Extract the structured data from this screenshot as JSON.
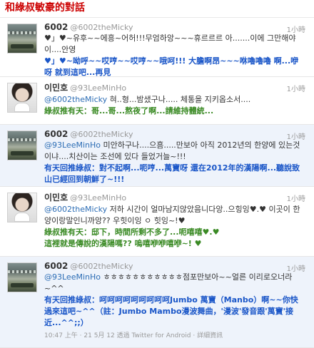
{
  "page_title": "和綠叔敏豪的對話",
  "tweets": [
    {
      "name": "6002",
      "handle": "@6002theMicky",
      "time": "1小時",
      "text": "♥」♥~유후~~에흥~어허!!!무엄하앙~~~휴르르르 아.......이에 그만해야이....안영",
      "translation": "♥」♥~呦呼~~哎哼~~哎哼~~哦呵!!! 大膽啊昂~~~咻嚕嚕嚕 啊...咿呀 就到這吧...再見"
    },
    {
      "name": "이민호",
      "handle": "@93LeeMinHo",
      "time": "1小時",
      "text_mention": "@6002theMicky",
      "text": "혀..형...밤샜구나..... 체통을 지키옵소서....",
      "translation": "綠叔推有天：哥...哥...熬夜了啊...請維持體統..."
    },
    {
      "name": "6002",
      "handle": "@6002theMicky",
      "time": "1小時",
      "text_mention": "@93LeeMinHo",
      "text": "미안하구나....으흠.....만보아 아직 2012년의 한양에 있는것이냐....치산이는 조선에 있다 들었거늘~!!!",
      "translation": "有天回推綠叔：對不起啊...呃哼...萬寶呀 還在2012年的漢陽啊...聽說致山已經回到朝鮮了~!!!"
    },
    {
      "name": "이민호",
      "handle": "@93LeeMinHo",
      "time": "1小時",
      "text_mention": "@6002theMicky",
      "text": "저하 시간이 얼마남지않았음니다앙..으힝잉♥.♥ 이곳이 한양이랑말인니까앙?? 우힛이잉 ㅇ 힛잉~!♥",
      "translation_1": "綠叔推有天：邸下，時間所剩不多了...呃嘻嘻♥.♥",
      "translation_2": "這裡就是傳說的漢陽嗎?? 嗚嘻咿咿嘻咿~! ♥"
    },
    {
      "name": "6002",
      "handle": "@6002theMicky",
      "time": "1小時",
      "text_mention": "@93LeeMinHo",
      "text": "ㅎㅎㅎㅎㅎㅎㅎㅎㅎㅎㅎ점포만보아~~얼른 이리로오너라~^^",
      "translation": "有天回推綠叔：呵呵呵呵呵呵呵呵呵Jumbo 萬寶（Manbo）啊~~你快過來這吧~^^（註：Jumbo Mambo漫波舞曲，'漫波'發音跟'萬寶'接近...^^;;）",
      "meta": "10:47 上午 · 21 5月 12 透過 Twitter for Android · 詳細資訊"
    }
  ]
}
